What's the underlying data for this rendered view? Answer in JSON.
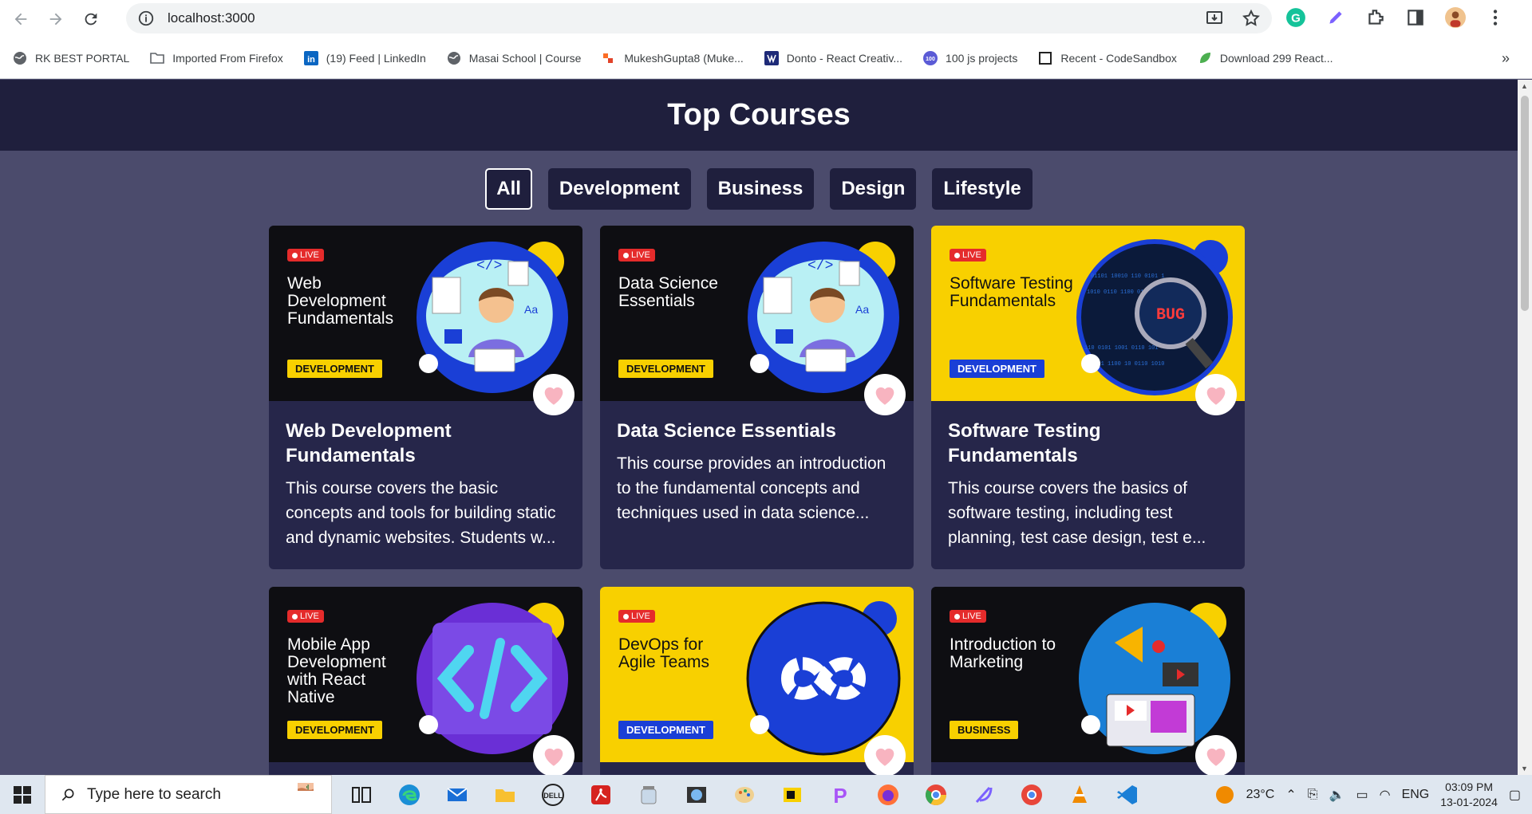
{
  "browser": {
    "url": "localhost:3000",
    "bookmarks": [
      {
        "label": "RK BEST PORTAL",
        "icon": "globe-icon"
      },
      {
        "label": "Imported From Firefox",
        "icon": "folder-icon"
      },
      {
        "label": "(19) Feed | LinkedIn",
        "icon": "linkedin-icon"
      },
      {
        "label": "Masai School | Course",
        "icon": "globe-icon"
      },
      {
        "label": "MukeshGupta8 (Muke...",
        "icon": "gitlab-icon"
      },
      {
        "label": "Donto - React Creativ...",
        "icon": "donto-icon"
      },
      {
        "label": "100 js projects",
        "icon": "hundred-icon"
      },
      {
        "label": "Recent - CodeSandbox",
        "icon": "codesandbox-icon"
      },
      {
        "label": "Download 299 React...",
        "icon": "leaf-icon"
      }
    ]
  },
  "page": {
    "title": "Top Courses",
    "filters": [
      {
        "label": "All",
        "active": true
      },
      {
        "label": "Development",
        "active": false
      },
      {
        "label": "Business",
        "active": false
      },
      {
        "label": "Design",
        "active": false
      },
      {
        "label": "Lifestyle",
        "active": false
      }
    ],
    "live_label": "LIVE",
    "courses": [
      {
        "banner_title": "Web Development Fundamentals",
        "tag": "DEVELOPMENT",
        "title": "Web Development Fundamentals",
        "description": "This course covers the basic concepts and tools for building static and dynamic websites. Students w...",
        "theme": "dark",
        "art": "developer-illustration"
      },
      {
        "banner_title": "Data Science Essentials",
        "tag": "DEVELOPMENT",
        "title": "Data Science Essentials",
        "description": "This course provides an introduction to the fundamental concepts and techniques used in data science...",
        "theme": "dark",
        "art": "developer-illustration"
      },
      {
        "banner_title": "Software Testing Fundamentals",
        "tag": "DEVELOPMENT",
        "title": "Software Testing Fundamentals",
        "description": "This course covers the basics of software testing, including test planning, test case design, test e...",
        "theme": "yellow",
        "art": "bug-magnifier-illustration"
      },
      {
        "banner_title": "Mobile App Development with React Native",
        "tag": "DEVELOPMENT",
        "title": "",
        "description": "",
        "theme": "dark",
        "art": "code-brackets-illustration"
      },
      {
        "banner_title": "DevOps for Agile Teams",
        "tag": "DEVELOPMENT",
        "title": "",
        "description": "",
        "theme": "yellow",
        "art": "infinity-loop-illustration"
      },
      {
        "banner_title": "Introduction to Marketing",
        "tag": "BUSINESS",
        "title": "",
        "description": "",
        "theme": "dark",
        "art": "marketing-illustration"
      }
    ],
    "bug_text": "BUG"
  },
  "taskbar": {
    "search_placeholder": "Type here to search",
    "temperature": "23°C",
    "language": "ENG",
    "time": "03:09 PM",
    "date": "13-01-2024"
  },
  "colors": {
    "header_bg": "#1f1f3d",
    "page_bg": "#4b4b6c",
    "card_bg": "#26264a",
    "yellow": "#f8d000",
    "blue": "#1a3fd6"
  }
}
